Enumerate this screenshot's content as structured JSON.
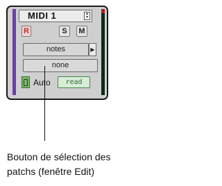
{
  "track": {
    "name": "MIDI 1"
  },
  "buttons": {
    "record": "R",
    "solo": "S",
    "mute": "M"
  },
  "midi_input": {
    "value": "notes"
  },
  "patch_select": {
    "value": "none"
  },
  "automation": {
    "label": "Auto",
    "mode": "read"
  },
  "caption": {
    "line1": "Bouton de sélection des",
    "line2": "patchs (fenêtre Edit)"
  },
  "colors": {
    "track_color": "#6b3fa8",
    "meter": "#0c2a18",
    "read_mode": "#2a6a2a"
  }
}
